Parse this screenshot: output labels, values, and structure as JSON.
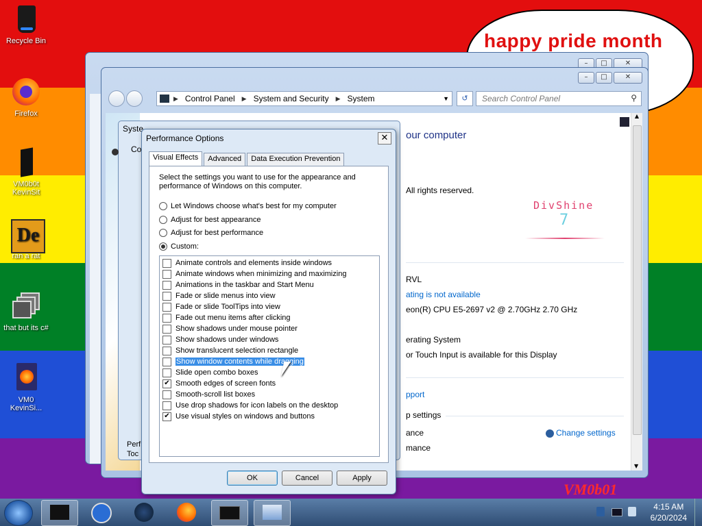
{
  "desktop": {
    "bubble_text": "happy pride month",
    "stripe_colors": [
      "#e30e0e",
      "#ff8c00",
      "#ffed00",
      "#008026",
      "#1f4fd6",
      "#7a1aa0"
    ],
    "watermark": "VM0b01",
    "icons": [
      {
        "label": "Recycle Bin"
      },
      {
        "label": "Firefox"
      },
      {
        "label": "VM0b0t KevinSit"
      },
      {
        "label": "ran a rat"
      },
      {
        "label": "that but its c#"
      },
      {
        "label": "VM0 KevinSi..."
      }
    ]
  },
  "explorer": {
    "breadcrumbs": [
      "Control Panel",
      "System and Security",
      "System"
    ],
    "search_placeholder": "Search Control Panel",
    "heading_partial": "our computer",
    "copyright_partial": "All rights reserved.",
    "brand_name": "DivShine",
    "brand_version": "7",
    "rows": [
      "RVL",
      "ating is not available",
      "eon(R) CPU E5-2697 v2 @ 2.70GHz   2.70 GHz",
      "erating System",
      "or Touch Input is available for this Display",
      "pport",
      "p settings",
      "ance",
      "mance"
    ],
    "change_settings": "Change settings",
    "left_bg_partial": [
      "Syste",
      "Co",
      "Perf",
      "Toc"
    ]
  },
  "dialog": {
    "title": "Performance Options",
    "tabs": [
      "Visual Effects",
      "Advanced",
      "Data Execution Prevention"
    ],
    "description": "Select the settings you want to use for the appearance and performance of Windows on this computer.",
    "radios": [
      {
        "label": "Let Windows choose what's best for my computer",
        "checked": false
      },
      {
        "label": "Adjust for best appearance",
        "checked": false
      },
      {
        "label": "Adjust for best performance",
        "checked": false
      },
      {
        "label": "Custom:",
        "checked": true
      }
    ],
    "options": [
      {
        "label": "Animate controls and elements inside windows",
        "checked": false
      },
      {
        "label": "Animate windows when minimizing and maximizing",
        "checked": false
      },
      {
        "label": "Animations in the taskbar and Start Menu",
        "checked": false
      },
      {
        "label": "Fade or slide menus into view",
        "checked": false
      },
      {
        "label": "Fade or slide ToolTips into view",
        "checked": false
      },
      {
        "label": "Fade out menu items after clicking",
        "checked": false
      },
      {
        "label": "Show shadows under mouse pointer",
        "checked": false
      },
      {
        "label": "Show shadows under windows",
        "checked": false
      },
      {
        "label": "Show translucent selection rectangle",
        "checked": false
      },
      {
        "label": "Show window contents while dragging",
        "checked": false,
        "selected": true
      },
      {
        "label": "Slide open combo boxes",
        "checked": false
      },
      {
        "label": "Smooth edges of screen fonts",
        "checked": true
      },
      {
        "label": "Smooth-scroll list boxes",
        "checked": false
      },
      {
        "label": "Use drop shadows for icon labels on the desktop",
        "checked": false
      },
      {
        "label": "Use visual styles on windows and buttons",
        "checked": true
      }
    ],
    "buttons": {
      "ok": "OK",
      "cancel": "Cancel",
      "apply": "Apply"
    }
  },
  "taskbar": {
    "time": "4:15 AM",
    "date": "6/20/2024"
  }
}
